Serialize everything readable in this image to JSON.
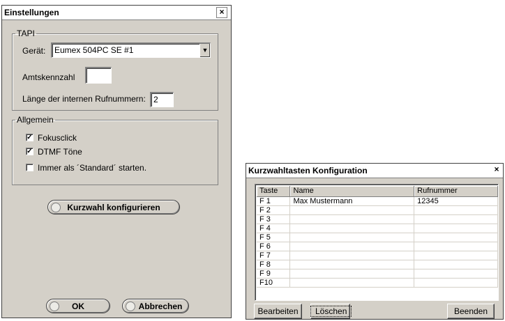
{
  "settings": {
    "title": "Einstellungen",
    "close_glyph": "×",
    "tapi": {
      "legend": "TAPI",
      "device_label": "Gerät:",
      "device_value": "Eumex 504PC SE #1",
      "amt_label": "Amtskennzahl",
      "amt_value": "",
      "length_label": "Länge der internen Rufnummern:",
      "length_value": "2"
    },
    "general": {
      "legend": "Allgemein",
      "options": [
        {
          "label": "Fokusclick",
          "checked": true
        },
        {
          "label": "DTMF Töne",
          "checked": true
        },
        {
          "label": "Immer als ´Standard´ starten.",
          "checked": false
        }
      ]
    },
    "speed_dial_button": "Kurzwahl konfigurieren",
    "ok_button": "OK",
    "cancel_button": "Abbrechen"
  },
  "speeddial": {
    "title": "Kurzwahltasten Konfiguration",
    "close_glyph": "×",
    "columns": [
      "Taste",
      "Name",
      "Rufnummer"
    ],
    "rows": [
      [
        "F 1",
        "Max Mustermann",
        "12345"
      ],
      [
        "F 2",
        "",
        ""
      ],
      [
        "F 3",
        "",
        ""
      ],
      [
        "F 4",
        "",
        ""
      ],
      [
        "F 5",
        "",
        ""
      ],
      [
        "F 6",
        "",
        ""
      ],
      [
        "F 7",
        "",
        ""
      ],
      [
        "F 8",
        "",
        ""
      ],
      [
        "F 9",
        "",
        ""
      ],
      [
        "F10",
        "",
        ""
      ]
    ],
    "edit_button": "Bearbeiten",
    "delete_button": "Löschen",
    "close_button": "Beenden"
  }
}
